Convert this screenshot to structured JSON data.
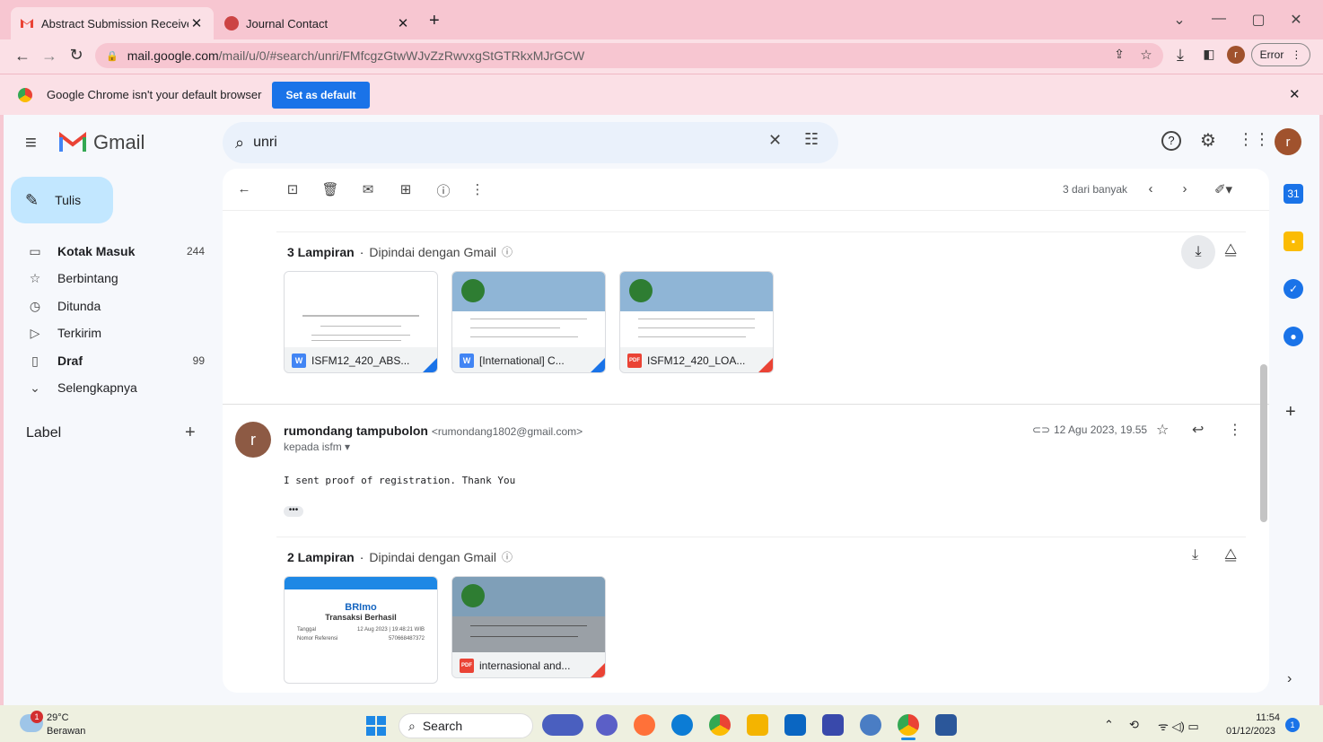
{
  "browser": {
    "tabs": [
      {
        "title": "Abstract Submission Received -",
        "active": true
      },
      {
        "title": "Journal Contact",
        "active": false
      }
    ],
    "url_host": "mail.google.com",
    "url_path": "/mail/u/0/#search/unri/FMfcgzGtwWJvZzRwvxgStGTRkxMJrGCW",
    "profile_button": "Error",
    "infobar_text": "Google Chrome isn't your default browser",
    "set_default_label": "Set as default"
  },
  "gmail": {
    "logo_text": "Gmail",
    "search_query": "unri",
    "compose_label": "Tulis",
    "avatar_letter": "r",
    "nav": [
      {
        "label": "Kotak Masuk",
        "count": "244",
        "icon": "inbox-icon",
        "bold": true
      },
      {
        "label": "Berbintang",
        "count": "",
        "icon": "star-icon"
      },
      {
        "label": "Ditunda",
        "count": "",
        "icon": "clock-icon"
      },
      {
        "label": "Terkirim",
        "count": "",
        "icon": "send-icon"
      },
      {
        "label": "Draf",
        "count": "99",
        "icon": "draft-icon",
        "bold": true
      },
      {
        "label": "Selengkapnya",
        "count": "",
        "icon": "chevron-down-icon"
      }
    ],
    "label_heading": "Label",
    "pager_text": "3 dari banyak"
  },
  "thread": {
    "attachments1": {
      "count_label": "3 Lampiran",
      "scan_label": "Dipindai dengan Gmail",
      "files": [
        {
          "name": "ISFM12_420_ABS...",
          "type": "W"
        },
        {
          "name": "[International] C...",
          "type": "W"
        },
        {
          "name": "ISFM12_420_LOA...",
          "type": "PDF"
        }
      ]
    },
    "message": {
      "sender_name": "rumondang tampubolon",
      "sender_email": "<rumondang1802@gmail.com>",
      "to_line": "kepada isfm",
      "date": "12 Agu 2023, 19.55",
      "body": "I sent proof of registration. Thank You",
      "avatar_letter": "r"
    },
    "attachments2": {
      "count_label": "2 Lampiran",
      "scan_label": "Dipindai dengan Gmail",
      "files": [
        {
          "name": "",
          "type": "image"
        },
        {
          "name": "internasional and...",
          "type": "PDF"
        }
      ],
      "brimo_brand": "BRImo",
      "brimo_title": "Transaksi Berhasil",
      "brimo_rows": [
        {
          "k": "Tanggal",
          "v": "12 Aug 2023 | 19:48:21 WIB"
        },
        {
          "k": "Nomor Referensi",
          "v": "570668487372"
        }
      ]
    }
  },
  "taskbar": {
    "weather_temp": "29°C",
    "weather_desc": "Berawan",
    "search_label": "Search",
    "time": "11:54",
    "date": "01/12/2023",
    "notif_count": "1"
  }
}
